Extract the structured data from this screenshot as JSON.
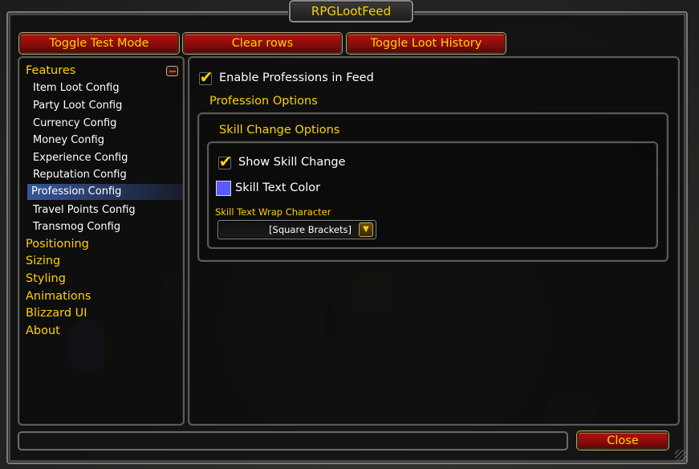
{
  "window": {
    "title": "RPGLootFeed"
  },
  "toolbar": {
    "toggle_test_mode": "Toggle Test Mode",
    "clear_rows": "Clear rows",
    "toggle_loot_history": "Toggle Loot History"
  },
  "sidebar": {
    "features_label": "Features",
    "features_items": [
      "Item Loot Config",
      "Party Loot Config",
      "Currency Config",
      "Money Config",
      "Experience Config",
      "Reputation Config",
      "Profession Config",
      "Travel Points Config",
      "Transmog Config"
    ],
    "selected_item": "Profession Config",
    "categories": [
      "Positioning",
      "Sizing",
      "Styling",
      "Animations",
      "Blizzard UI",
      "About"
    ]
  },
  "main": {
    "enable_professions": {
      "label": "Enable Professions in Feed",
      "checked": true
    },
    "profession_options_heading": "Profession Options",
    "skill_change_options_heading": "Skill Change Options",
    "show_skill_change": {
      "label": "Show Skill Change",
      "checked": true
    },
    "skill_text_color": {
      "label": "Skill Text Color",
      "color": "#5a5aff"
    },
    "wrap_character": {
      "label": "Skill Text Wrap Character",
      "value": "[Square Brackets]"
    }
  },
  "footer": {
    "close_label": "Close"
  },
  "colors": {
    "gold": "#ffd100",
    "button_red": "#9a0e0e",
    "selection_blue": "#466ec8"
  }
}
